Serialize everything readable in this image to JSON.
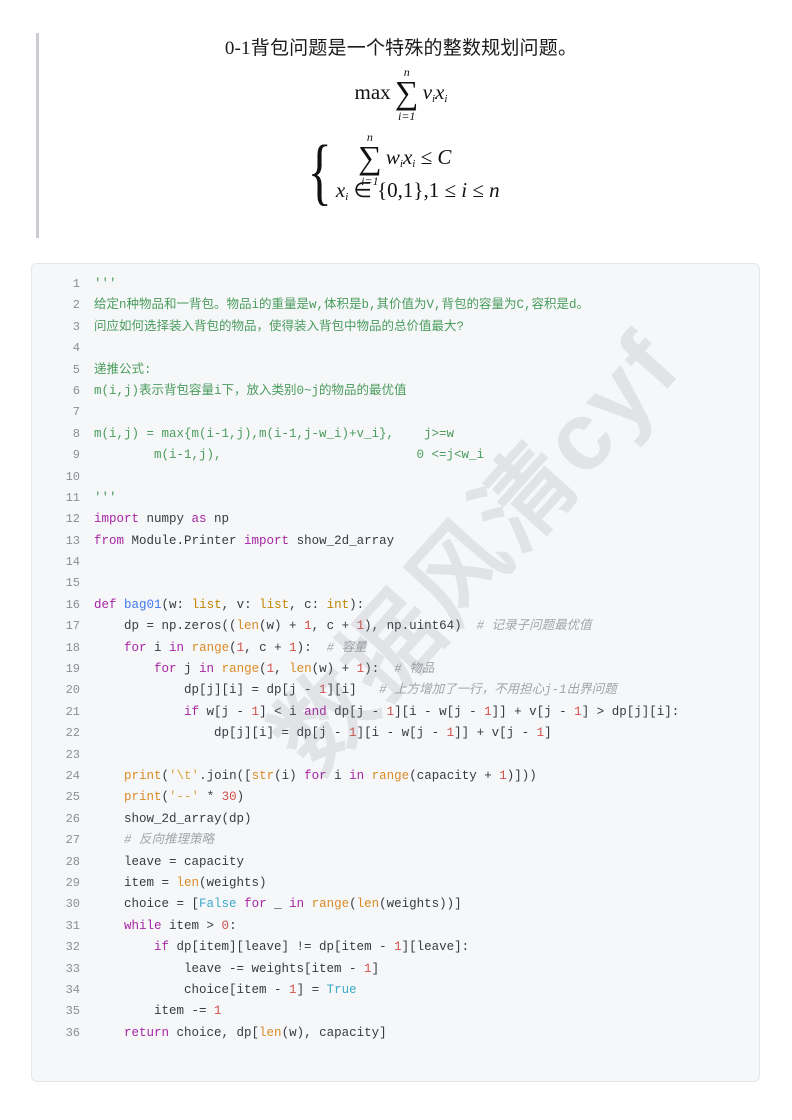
{
  "document": {
    "title": "0-1背包问题是一个特殊的整数规划问题。",
    "equation_objective": {
      "operator": "max",
      "sigma_top": "n",
      "sigma_bottom": "i=1",
      "body_var1": "v",
      "body_sub1": "i",
      "body_var2": "x",
      "body_sub2": "i"
    },
    "equation_constraints": {
      "row1": {
        "sigma_top": "n",
        "sigma_bottom": "i=1",
        "var1": "w",
        "sub1": "i",
        "var2": "x",
        "sub2": "i",
        "relation": "≤",
        "rhs": "C"
      },
      "row2": "x_i ∈ {0,1},1 ≤ i ≤ n",
      "row2_parts": {
        "x": "x",
        "xsub": "i",
        "in": "∈ {0,1},1 ≤",
        "i": "i",
        "le": "≤",
        "n": "n"
      }
    }
  },
  "watermark": {
    "text": "数据风清cyf",
    "color": "#787c82"
  },
  "code_block": {
    "language": "python",
    "background": "#f6f7f9",
    "border_color": "#e3e6ea",
    "line_number_color": "#8a8f98",
    "first_line": 1,
    "last_line": 36,
    "lines": [
      {
        "n": "1",
        "tokens": [
          {
            "t": "'''",
            "c": "t-doc"
          }
        ]
      },
      {
        "n": "2",
        "tokens": [
          {
            "t": "给定n种物品和一背包。物品i的重量是w,体积是b,其价值为V,背包的容量为C,容积是d。",
            "c": "t-doc"
          }
        ]
      },
      {
        "n": "3",
        "tokens": [
          {
            "t": "问应如何选择装入背包的物品，使得装入背包中物品的总价值最大?",
            "c": "t-doc"
          }
        ]
      },
      {
        "n": "4",
        "tokens": []
      },
      {
        "n": "5",
        "tokens": [
          {
            "t": "递推公式:",
            "c": "t-doc"
          }
        ]
      },
      {
        "n": "6",
        "tokens": [
          {
            "t": "m(i,j)表示背包容量i下，放入类别0~j的物品的最优值",
            "c": "t-doc"
          }
        ]
      },
      {
        "n": "7",
        "tokens": []
      },
      {
        "n": "8",
        "tokens": [
          {
            "t": "m(i,j) = max{m(i-1,j),m(i-1,j-w_i)+v_i},    j>=w",
            "c": "t-doc"
          }
        ]
      },
      {
        "n": "9",
        "tokens": [
          {
            "t": "        m(i-1,j),                          0 <=j<w_i",
            "c": "t-doc"
          }
        ]
      },
      {
        "n": "10",
        "tokens": []
      },
      {
        "n": "11",
        "tokens": [
          {
            "t": "'''",
            "c": "t-doc"
          }
        ]
      },
      {
        "n": "12",
        "tokens": [
          {
            "t": "import",
            "c": "t-kw"
          },
          {
            "t": " numpy ",
            "c": "t-plain"
          },
          {
            "t": "as",
            "c": "t-kw"
          },
          {
            "t": " np",
            "c": "t-plain"
          }
        ]
      },
      {
        "n": "13",
        "tokens": [
          {
            "t": "from",
            "c": "t-kw"
          },
          {
            "t": " Module.Printer ",
            "c": "t-plain"
          },
          {
            "t": "import",
            "c": "t-kw"
          },
          {
            "t": " show_2d_array",
            "c": "t-plain"
          }
        ]
      },
      {
        "n": "14",
        "tokens": []
      },
      {
        "n": "15",
        "tokens": []
      },
      {
        "n": "16",
        "tokens": [
          {
            "t": "def",
            "c": "t-kw"
          },
          {
            "t": " ",
            "c": "t-plain"
          },
          {
            "t": "bag01",
            "c": "t-fn"
          },
          {
            "t": "(w: ",
            "c": "t-plain"
          },
          {
            "t": "list",
            "c": "t-type"
          },
          {
            "t": ", v: ",
            "c": "t-plain"
          },
          {
            "t": "list",
            "c": "t-type"
          },
          {
            "t": ", c: ",
            "c": "t-plain"
          },
          {
            "t": "int",
            "c": "t-type"
          },
          {
            "t": "):",
            "c": "t-plain"
          }
        ]
      },
      {
        "n": "17",
        "tokens": [
          {
            "t": "    dp = np.zeros((",
            "c": "t-plain"
          },
          {
            "t": "len",
            "c": "t-builtin"
          },
          {
            "t": "(w) + ",
            "c": "t-plain"
          },
          {
            "t": "1",
            "c": "t-num"
          },
          {
            "t": ", c + ",
            "c": "t-plain"
          },
          {
            "t": "1",
            "c": "t-num"
          },
          {
            "t": "), np.uint64)  ",
            "c": "t-plain"
          },
          {
            "t": "# 记录子问题最优值",
            "c": "t-com"
          }
        ]
      },
      {
        "n": "18",
        "tokens": [
          {
            "t": "    ",
            "c": "t-plain"
          },
          {
            "t": "for",
            "c": "t-kw"
          },
          {
            "t": " i ",
            "c": "t-plain"
          },
          {
            "t": "in",
            "c": "t-kw"
          },
          {
            "t": " ",
            "c": "t-plain"
          },
          {
            "t": "range",
            "c": "t-builtin"
          },
          {
            "t": "(",
            "c": "t-plain"
          },
          {
            "t": "1",
            "c": "t-num"
          },
          {
            "t": ", c + ",
            "c": "t-plain"
          },
          {
            "t": "1",
            "c": "t-num"
          },
          {
            "t": "):  ",
            "c": "t-plain"
          },
          {
            "t": "# 容量",
            "c": "t-com"
          }
        ]
      },
      {
        "n": "19",
        "tokens": [
          {
            "t": "        ",
            "c": "t-plain"
          },
          {
            "t": "for",
            "c": "t-kw"
          },
          {
            "t": " j ",
            "c": "t-plain"
          },
          {
            "t": "in",
            "c": "t-kw"
          },
          {
            "t": " ",
            "c": "t-plain"
          },
          {
            "t": "range",
            "c": "t-builtin"
          },
          {
            "t": "(",
            "c": "t-plain"
          },
          {
            "t": "1",
            "c": "t-num"
          },
          {
            "t": ", ",
            "c": "t-plain"
          },
          {
            "t": "len",
            "c": "t-builtin"
          },
          {
            "t": "(w) + ",
            "c": "t-plain"
          },
          {
            "t": "1",
            "c": "t-num"
          },
          {
            "t": "):  ",
            "c": "t-plain"
          },
          {
            "t": "# 物品",
            "c": "t-com"
          }
        ]
      },
      {
        "n": "20",
        "tokens": [
          {
            "t": "            dp[j][i] = dp[j - ",
            "c": "t-plain"
          },
          {
            "t": "1",
            "c": "t-num"
          },
          {
            "t": "][i]   ",
            "c": "t-plain"
          },
          {
            "t": "# 上方增加了一行，不用担心j-1出界问题",
            "c": "t-com"
          }
        ]
      },
      {
        "n": "21",
        "tokens": [
          {
            "t": "            ",
            "c": "t-plain"
          },
          {
            "t": "if",
            "c": "t-kw"
          },
          {
            "t": " w[j - ",
            "c": "t-plain"
          },
          {
            "t": "1",
            "c": "t-num"
          },
          {
            "t": "] < i ",
            "c": "t-plain"
          },
          {
            "t": "and",
            "c": "t-kw"
          },
          {
            "t": " dp[j - ",
            "c": "t-plain"
          },
          {
            "t": "1",
            "c": "t-num"
          },
          {
            "t": "][i - w[j - ",
            "c": "t-plain"
          },
          {
            "t": "1",
            "c": "t-num"
          },
          {
            "t": "]] + v[j - ",
            "c": "t-plain"
          },
          {
            "t": "1",
            "c": "t-num"
          },
          {
            "t": "] > dp[j][i]:",
            "c": "t-plain"
          }
        ]
      },
      {
        "n": "22",
        "tokens": [
          {
            "t": "                dp[j][i] = dp[j - ",
            "c": "t-plain"
          },
          {
            "t": "1",
            "c": "t-num"
          },
          {
            "t": "][i - w[j - ",
            "c": "t-plain"
          },
          {
            "t": "1",
            "c": "t-num"
          },
          {
            "t": "]] + v[j - ",
            "c": "t-plain"
          },
          {
            "t": "1",
            "c": "t-num"
          },
          {
            "t": "]",
            "c": "t-plain"
          }
        ]
      },
      {
        "n": "23",
        "tokens": []
      },
      {
        "n": "24",
        "tokens": [
          {
            "t": "    ",
            "c": "t-plain"
          },
          {
            "t": "print",
            "c": "t-builtin"
          },
          {
            "t": "(",
            "c": "t-plain"
          },
          {
            "t": "'\\t'",
            "c": "t-strlit"
          },
          {
            "t": ".join([",
            "c": "t-plain"
          },
          {
            "t": "str",
            "c": "t-builtin"
          },
          {
            "t": "(i) ",
            "c": "t-plain"
          },
          {
            "t": "for",
            "c": "t-kw"
          },
          {
            "t": " i ",
            "c": "t-plain"
          },
          {
            "t": "in",
            "c": "t-kw"
          },
          {
            "t": " ",
            "c": "t-plain"
          },
          {
            "t": "range",
            "c": "t-builtin"
          },
          {
            "t": "(capacity + ",
            "c": "t-plain"
          },
          {
            "t": "1",
            "c": "t-num"
          },
          {
            "t": ")]))",
            "c": "t-plain"
          }
        ]
      },
      {
        "n": "25",
        "tokens": [
          {
            "t": "    ",
            "c": "t-plain"
          },
          {
            "t": "print",
            "c": "t-builtin"
          },
          {
            "t": "(",
            "c": "t-plain"
          },
          {
            "t": "'--'",
            "c": "t-strlit"
          },
          {
            "t": " * ",
            "c": "t-plain"
          },
          {
            "t": "30",
            "c": "t-num"
          },
          {
            "t": ")",
            "c": "t-plain"
          }
        ]
      },
      {
        "n": "26",
        "tokens": [
          {
            "t": "    show_2d_array(dp)",
            "c": "t-plain"
          }
        ]
      },
      {
        "n": "27",
        "tokens": [
          {
            "t": "    ",
            "c": "t-plain"
          },
          {
            "t": "# 反向推理策略",
            "c": "t-com"
          }
        ]
      },
      {
        "n": "28",
        "tokens": [
          {
            "t": "    leave = capacity",
            "c": "t-plain"
          }
        ]
      },
      {
        "n": "29",
        "tokens": [
          {
            "t": "    item = ",
            "c": "t-plain"
          },
          {
            "t": "len",
            "c": "t-builtin"
          },
          {
            "t": "(weights)",
            "c": "t-plain"
          }
        ]
      },
      {
        "n": "30",
        "tokens": [
          {
            "t": "    choice = [",
            "c": "t-plain"
          },
          {
            "t": "False",
            "c": "t-const"
          },
          {
            "t": " ",
            "c": "t-plain"
          },
          {
            "t": "for",
            "c": "t-kw"
          },
          {
            "t": " _ ",
            "c": "t-plain"
          },
          {
            "t": "in",
            "c": "t-kw"
          },
          {
            "t": " ",
            "c": "t-plain"
          },
          {
            "t": "range",
            "c": "t-builtin"
          },
          {
            "t": "(",
            "c": "t-plain"
          },
          {
            "t": "len",
            "c": "t-builtin"
          },
          {
            "t": "(weights))]",
            "c": "t-plain"
          }
        ]
      },
      {
        "n": "31",
        "tokens": [
          {
            "t": "    ",
            "c": "t-plain"
          },
          {
            "t": "while",
            "c": "t-kw"
          },
          {
            "t": " item > ",
            "c": "t-plain"
          },
          {
            "t": "0",
            "c": "t-num"
          },
          {
            "t": ":",
            "c": "t-plain"
          }
        ]
      },
      {
        "n": "32",
        "tokens": [
          {
            "t": "        ",
            "c": "t-plain"
          },
          {
            "t": "if",
            "c": "t-kw"
          },
          {
            "t": " dp[item][leave] != dp[item - ",
            "c": "t-plain"
          },
          {
            "t": "1",
            "c": "t-num"
          },
          {
            "t": "][leave]:",
            "c": "t-plain"
          }
        ]
      },
      {
        "n": "33",
        "tokens": [
          {
            "t": "            leave -= weights[item - ",
            "c": "t-plain"
          },
          {
            "t": "1",
            "c": "t-num"
          },
          {
            "t": "]",
            "c": "t-plain"
          }
        ]
      },
      {
        "n": "34",
        "tokens": [
          {
            "t": "            choice[item - ",
            "c": "t-plain"
          },
          {
            "t": "1",
            "c": "t-num"
          },
          {
            "t": "] = ",
            "c": "t-plain"
          },
          {
            "t": "True",
            "c": "t-const"
          }
        ]
      },
      {
        "n": "35",
        "tokens": [
          {
            "t": "        item -= ",
            "c": "t-plain"
          },
          {
            "t": "1",
            "c": "t-num"
          }
        ]
      },
      {
        "n": "36",
        "tokens": [
          {
            "t": "    ",
            "c": "t-plain"
          },
          {
            "t": "return",
            "c": "t-kw"
          },
          {
            "t": " choice, dp[",
            "c": "t-plain"
          },
          {
            "t": "len",
            "c": "t-builtin"
          },
          {
            "t": "(w), capacity]",
            "c": "t-plain"
          }
        ]
      }
    ]
  }
}
